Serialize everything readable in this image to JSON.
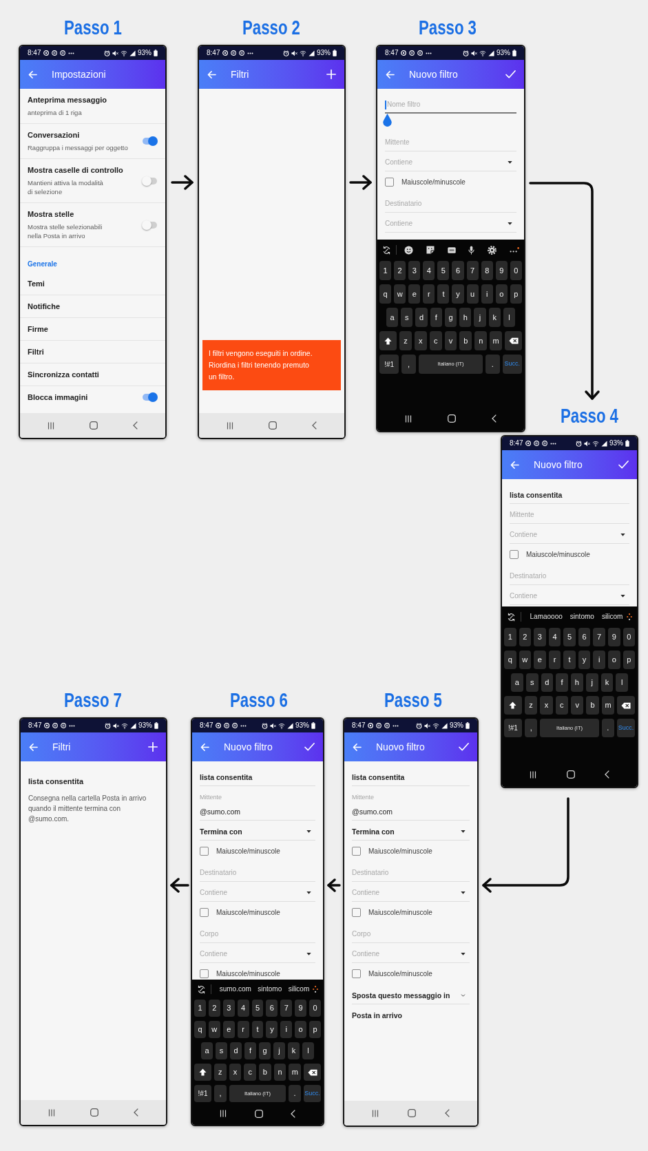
{
  "steps": [
    {
      "title": "Passo 1",
      "status_bar": {
        "time": "8:47",
        "battery": "93%"
      },
      "app_bar": {
        "title": "Impostazioni"
      },
      "content": {
        "kind": "settings",
        "items": [
          {
            "kind": "setting",
            "title": "Anteprima messaggio",
            "subtitle": "anteprima di 1 riga"
          },
          {
            "kind": "toggle",
            "title": "Conversazioni",
            "subtitle": "Raggruppa i messaggi per oggetto",
            "on": true
          },
          {
            "kind": "toggle",
            "title": "Mostra caselle di controllo",
            "subtitle": "Mantieni attiva la modalità\ndi selezione",
            "on": false
          },
          {
            "kind": "toggle",
            "title": "Mostra stelle",
            "subtitle": "Mostra stelle selezionabili\nnella Posta in arrivo",
            "on": false
          },
          {
            "kind": "header",
            "title": "Generale"
          },
          {
            "kind": "setting",
            "title": "Temi"
          },
          {
            "kind": "setting",
            "title": "Notifiche"
          },
          {
            "kind": "setting",
            "title": "Firme"
          },
          {
            "kind": "setting",
            "title": "Filtri"
          },
          {
            "kind": "setting",
            "title": "Sincronizza contatti"
          },
          {
            "kind": "toggle",
            "title": "Blocca immagini",
            "on": true
          }
        ]
      }
    },
    {
      "title": "Passo 2",
      "status_bar": {
        "time": "8:47",
        "battery": "93%"
      },
      "app_bar": {
        "title": "Filtri",
        "actions": [
          {
            "kind": "add"
          }
        ]
      },
      "content": {
        "kind": "filters",
        "banner": "I filtri vengono eseguiti in ordine.\nRiordina i filtri tenendo premuto\nun filtro."
      }
    },
    {
      "title": "Passo 3",
      "status_bar": {
        "time": "8:47",
        "battery": "93%"
      },
      "app_bar": {
        "title": "Nuovo filtro",
        "actions": [
          {
            "kind": "confirm"
          }
        ]
      },
      "content": {
        "kind": "form",
        "fields": [
          {
            "kind": "name",
            "placeholder": "Nome filtro",
            "focused": true
          },
          {
            "kind": "text",
            "placeholder": "Mittente",
            "focused": false
          },
          {
            "kind": "select",
            "placeholder": "Contiene"
          },
          {
            "kind": "checkbox",
            "label": "Maiuscole/minuscole",
            "checked": false
          },
          {
            "kind": "text",
            "placeholder": "Destinatario",
            "focused": false
          },
          {
            "kind": "select",
            "placeholder": "Contiene"
          }
        ]
      },
      "keyboard": {
        "rows": [
          [
            "1",
            "2",
            "3",
            "4",
            "5",
            "6",
            "7",
            "8",
            "9",
            "0"
          ],
          [
            "q",
            "w",
            "e",
            "r",
            "t",
            "y",
            "u",
            "i",
            "o",
            "p"
          ],
          [
            "a",
            "s",
            "d",
            "f",
            "g",
            "h",
            "j",
            "k",
            "l"
          ],
          [
            "z",
            "x",
            "c",
            "v",
            "b",
            "n",
            "m"
          ]
        ],
        "symbols_key": "!#1",
        "comma_key": ",",
        "space_key": "Italiano (IT)",
        "period_key": ".",
        "enter_key": "Succ."
      }
    },
    {
      "title": "Passo 4",
      "status_bar": {
        "time": "8:47",
        "battery": "93%"
      },
      "app_bar": {
        "title": "Nuovo filtro",
        "actions": [
          {
            "kind": "confirm"
          }
        ]
      },
      "content": {
        "kind": "form",
        "fields": [
          {
            "kind": "name",
            "value": "lista consentita",
            "focused": false
          },
          {
            "kind": "text",
            "placeholder": "Mittente",
            "focused": false
          },
          {
            "kind": "select",
            "placeholder": "Contiene"
          },
          {
            "kind": "checkbox",
            "label": "Maiuscole/minuscole",
            "checked": false
          },
          {
            "kind": "text",
            "placeholder": "Destinatario",
            "focused": false
          },
          {
            "kind": "select",
            "placeholder": "Contiene"
          }
        ]
      },
      "keyboard": {
        "suggestions": [
          "Lamaoooo",
          "sintomo",
          "silicom"
        ],
        "rows": [
          [
            "1",
            "2",
            "3",
            "4",
            "5",
            "6",
            "7",
            "9",
            "0"
          ],
          [
            "q",
            "w",
            "e",
            "r",
            "t",
            "y",
            "i",
            "o",
            "p"
          ],
          [
            "a",
            "s",
            "d",
            "f",
            "h",
            "j",
            "k",
            "l"
          ],
          [
            "z",
            "x",
            "c",
            "v",
            "b",
            "m"
          ]
        ],
        "symbols_key": "!#1",
        "comma_key": ",",
        "space_key": "Italiano (IT)",
        "period_key": ".",
        "enter_key": "Succ."
      }
    },
    {
      "title": "Passo 7",
      "status_bar": {
        "time": "8:47",
        "battery": "93%"
      },
      "app_bar": {
        "title": "Filtri",
        "actions": [
          {
            "kind": "add"
          }
        ]
      },
      "content": {
        "kind": "filters",
        "filters": [
          {
            "name": "lista consentita",
            "description": "Consegna nella cartella Posta in arrivo\nquando il mittente termina con\n@sumo.com."
          }
        ]
      }
    },
    {
      "title": "Passo 6",
      "status_bar": {
        "time": "8:47",
        "battery": "93%"
      },
      "app_bar": {
        "title": "Nuovo filtro",
        "actions": [
          {
            "kind": "confirm"
          }
        ]
      },
      "content": {
        "kind": "form",
        "fields": [
          {
            "kind": "name",
            "value": "lista consentita",
            "focused": false
          },
          {
            "kind": "text",
            "label": "Mittente",
            "value": "@sumo.com",
            "focused": false
          },
          {
            "kind": "select",
            "value": "Termina con"
          },
          {
            "kind": "checkbox",
            "label": "Maiuscole/minuscole",
            "checked": false
          },
          {
            "kind": "text",
            "placeholder": "Destinatario",
            "focused": false
          },
          {
            "kind": "select",
            "placeholder": "Contiene"
          },
          {
            "kind": "checkbox",
            "label": "Maiuscole/minuscole",
            "checked": false
          },
          {
            "kind": "text",
            "placeholder": "Corpo",
            "focused": false
          },
          {
            "kind": "select",
            "placeholder": "Contiene"
          },
          {
            "kind": "checkbox",
            "label": "Maiuscole/minuscole",
            "checked": false
          }
        ]
      },
      "keyboard": {
        "suggestions": [
          "sumo.com",
          "sintomo",
          "silicom"
        ],
        "rows": [
          [
            "1",
            "2",
            "3",
            "4",
            "5",
            "6",
            "7",
            "9",
            "0"
          ],
          [
            "q",
            "w",
            "e",
            "r",
            "t",
            "y",
            "i",
            "o",
            "p"
          ],
          [
            "a",
            "s",
            "d",
            "f",
            "g",
            "j",
            "k",
            "l"
          ],
          [
            "z",
            "x",
            "c",
            "b",
            "n",
            "m"
          ]
        ],
        "symbols_key": "!#1",
        "comma_key": ",",
        "space_key": "Italiano (IT)",
        "period_key": ".",
        "enter_key": "Succ."
      }
    },
    {
      "title": "Passo 5",
      "status_bar": {
        "time": "8:47",
        "battery": "93%"
      },
      "app_bar": {
        "title": "Nuovo filtro",
        "actions": [
          {
            "kind": "confirm"
          }
        ]
      },
      "content": {
        "kind": "form",
        "fields": [
          {
            "kind": "name",
            "value": "lista consentita",
            "focused": false
          },
          {
            "kind": "text",
            "label": "Mittente",
            "value": "@sumo.com",
            "focused": false
          },
          {
            "kind": "select",
            "value": "Termina con"
          },
          {
            "kind": "checkbox",
            "label": "Maiuscole/minuscole",
            "checked": false
          },
          {
            "kind": "text",
            "placeholder": "Destinatario",
            "focused": false
          },
          {
            "kind": "select",
            "placeholder": "Contiene"
          },
          {
            "kind": "checkbox",
            "label": "Maiuscole/minuscole",
            "checked": false
          },
          {
            "kind": "text",
            "placeholder": "Corpo",
            "focused": false
          },
          {
            "kind": "select",
            "placeholder": "Contiene"
          },
          {
            "kind": "checkbox",
            "label": "Maiuscole/minuscole",
            "checked": false
          },
          {
            "kind": "menu",
            "value": "Sposta questo messaggio in"
          },
          {
            "kind": "static",
            "value": "Posta in arrivo"
          }
        ]
      }
    }
  ]
}
